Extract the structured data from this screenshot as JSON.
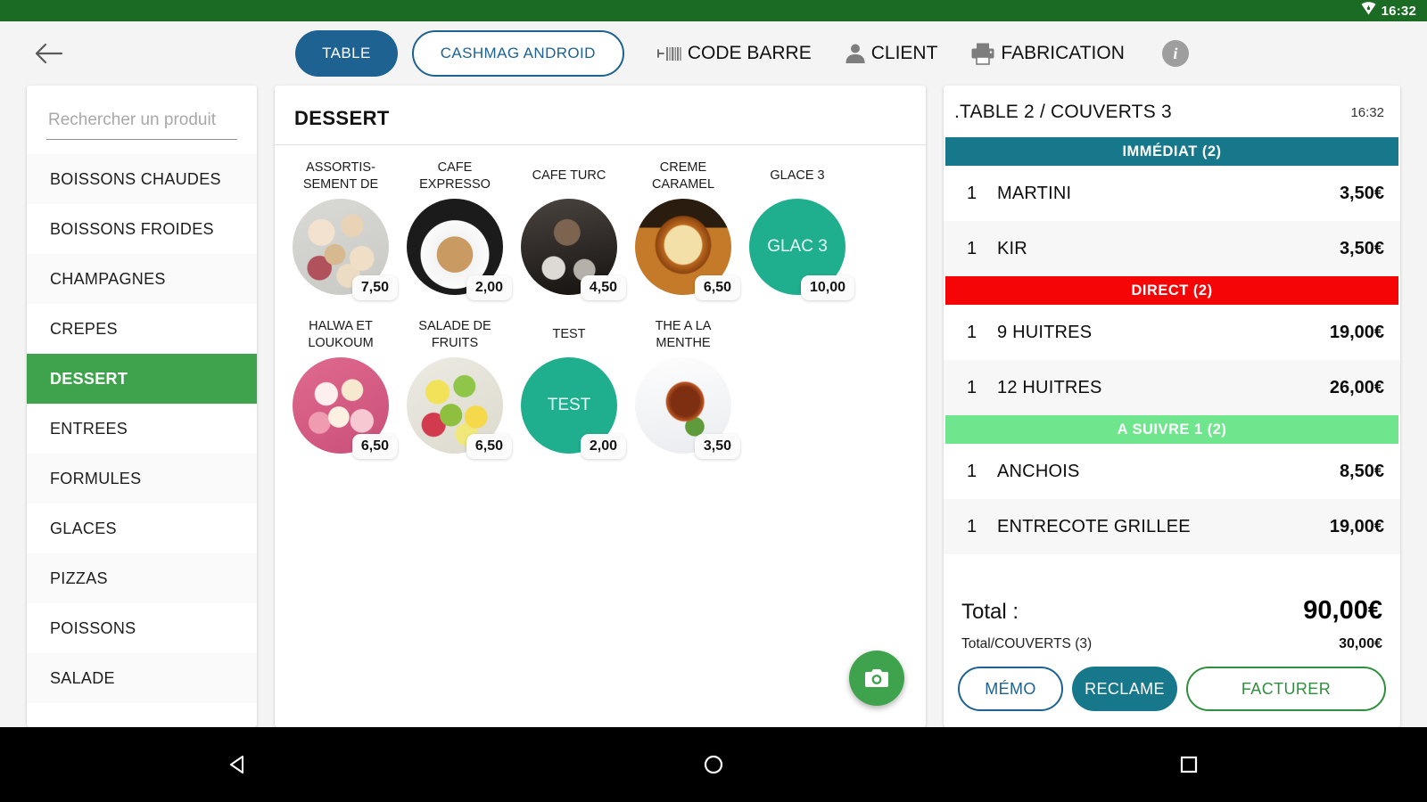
{
  "status_bar": {
    "clock": "16:32",
    "wifi_icon": "wifi-icon"
  },
  "header": {
    "back_icon": "back-arrow-icon",
    "table_button": "TABLE",
    "cashmag_button": "CASHMAG ANDROID",
    "code_barre": "CODE BARRE",
    "code_barre_icon": "barcode-icon",
    "client": "CLIENT",
    "client_icon": "person-icon",
    "fabrication": "FABRICATION",
    "fabrication_icon": "printer-icon",
    "info_icon": "info-icon",
    "info_glyph": "i"
  },
  "sidebar": {
    "search_placeholder": "Rechercher un produit",
    "search_value": "",
    "items": [
      {
        "label": "BOISSONS CHAUDES",
        "active": false
      },
      {
        "label": "BOISSONS FROIDES",
        "active": false
      },
      {
        "label": "CHAMPAGNES",
        "active": false
      },
      {
        "label": "CREPES",
        "active": false
      },
      {
        "label": "DESSERT",
        "active": true
      },
      {
        "label": "ENTREES",
        "active": false
      },
      {
        "label": "FORMULES",
        "active": false
      },
      {
        "label": "GLACES",
        "active": false
      },
      {
        "label": "PIZZAS",
        "active": false
      },
      {
        "label": "POISSONS",
        "active": false
      },
      {
        "label": "SALADE",
        "active": false
      }
    ]
  },
  "products": {
    "title": "DESSERT",
    "camera_fab_icon": "camera-icon",
    "items": [
      {
        "name": "ASSORTISSEMENT DE",
        "label": "ASSORTIS-\nSEMENT DE",
        "price": "7,50",
        "image": "photo",
        "image_kind": "pastries"
      },
      {
        "name": "CAFE EXPRESSO",
        "label": "CAFE\nEXPRESSO",
        "price": "2,00",
        "image": "photo",
        "image_kind": "latte"
      },
      {
        "name": "CAFE TURC",
        "label": "CAFE TURC",
        "price": "4,50",
        "image": "photo",
        "image_kind": "turkish-coffee"
      },
      {
        "name": "CREME CARAMEL",
        "label": "CREME\nCARAMEL",
        "price": "6,50",
        "image": "photo",
        "image_kind": "caramel-flan"
      },
      {
        "name": "GLACE 3",
        "label": "GLACE 3",
        "price": "10,00",
        "image": "placeholder",
        "placeholder_text": "GLAC 3"
      },
      {
        "name": "HALWA ET LOUKOUM",
        "label": "HALWA ET\nLOUKOUM",
        "price": "6,50",
        "image": "photo",
        "image_kind": "loukoum"
      },
      {
        "name": "SALADE DE FRUITS",
        "label": "SALADE DE\nFRUITS",
        "price": "6,50",
        "image": "photo",
        "image_kind": "fruit-salad"
      },
      {
        "name": "TEST",
        "label": "TEST",
        "price": "2,00",
        "image": "placeholder",
        "placeholder_text": "TEST"
      },
      {
        "name": "THE A LA MENTHE",
        "label": "THE A LA\nMENTHE",
        "price": "3,50",
        "image": "photo",
        "image_kind": "mint-tea"
      }
    ]
  },
  "ticket": {
    "title": ".TABLE 2 / COUVERTS 3",
    "time": "16:32",
    "sections": [
      {
        "header": "IMMÉDIAT (2)",
        "color": "#16788a",
        "lines": [
          {
            "qty": "1",
            "name": "MARTINI",
            "price": "3,50€"
          },
          {
            "qty": "1",
            "name": "KIR",
            "price": "3,50€"
          }
        ]
      },
      {
        "header": "DIRECT (2)",
        "color": "#f50505",
        "lines": [
          {
            "qty": "1",
            "name": "9 HUITRES",
            "price": "19,00€"
          },
          {
            "qty": "1",
            "name": "12 HUITRES",
            "price": "26,00€"
          }
        ]
      },
      {
        "header": "A SUIVRE 1 (2)",
        "color": "#6fe68e",
        "lines": [
          {
            "qty": "1",
            "name": "ANCHOIS",
            "price": "8,50€"
          },
          {
            "qty": "1",
            "name": "ENTRECOTE GRILLEE",
            "price": "19,00€"
          }
        ]
      }
    ],
    "total_label": "Total :",
    "total_value": "90,00€",
    "subtotal_label": "Total/COUVERTS (3)",
    "subtotal_value": "30,00€",
    "actions": {
      "memo": "MÉMO",
      "reclame": "RECLAME",
      "facturer": "FACTURER"
    }
  },
  "nav_bar": {
    "back_icon": "triangle-back-icon",
    "home_icon": "circle-home-icon",
    "recents_icon": "square-recents-icon"
  }
}
